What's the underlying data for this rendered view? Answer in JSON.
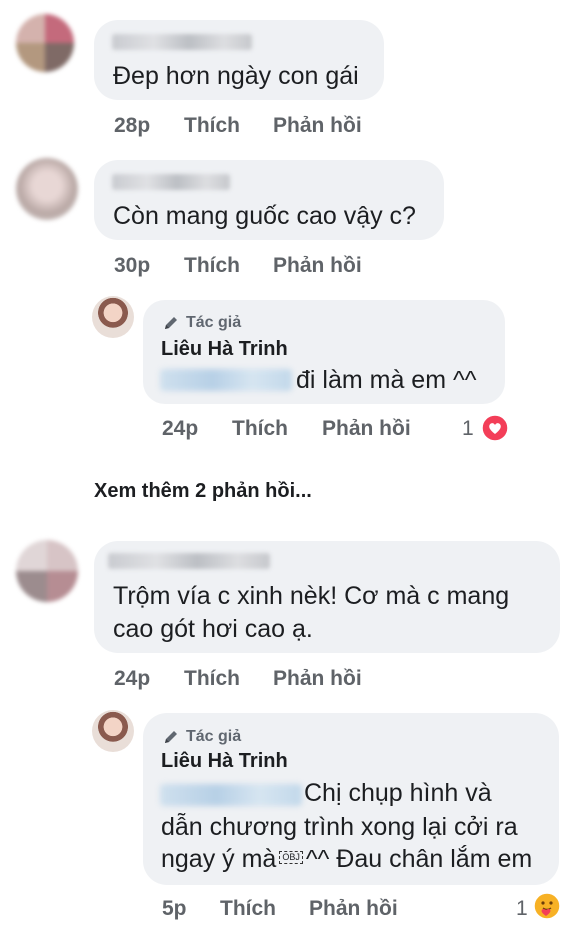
{
  "comments": [
    {
      "text": "Đep hơn ngày con gái",
      "time": "28p",
      "like_label": "Thích",
      "reply_label": "Phản hồi"
    },
    {
      "text": "Còn mang guốc cao vậy c?",
      "time": "30p",
      "like_label": "Thích",
      "reply_label": "Phản hồi",
      "reply": {
        "author_badge": "Tác giả",
        "author_name": "Liêu Hà Trinh",
        "text": "đi làm mà em ^^",
        "time": "24p",
        "like_label": "Thích",
        "reply_label": "Phản hồi",
        "reaction_count": "1",
        "reaction": "heart-icon"
      }
    },
    {
      "text_line1": "Trộm vía c xinh nèk! Cơ mà c mang",
      "text_line2": "cao gót hơi cao ạ.",
      "time": "24p",
      "like_label": "Thích",
      "reply_label": "Phản hồi",
      "reply": {
        "author_badge": "Tác giả",
        "author_name": "Liêu Hà Trinh",
        "text_line1": "Chị chụp hình và",
        "text_line2": "dẫn chương trình xong lại cởi ra",
        "text_line3a": "ngay ý mà",
        "obj_glyph": "OBJ",
        "text_line3b": "^^ Đau chân lắm em",
        "time": "5p",
        "like_label": "Thích",
        "reply_label": "Phản hồi",
        "reaction_count": "1",
        "reaction": "care-icon"
      }
    }
  ],
  "view_more": "Xem thêm 2 phản hồi...",
  "colors": {
    "bubble": "#eff1f4",
    "action_text": "#5f6368",
    "heart": "#f33e58",
    "care": "#f7b125"
  }
}
